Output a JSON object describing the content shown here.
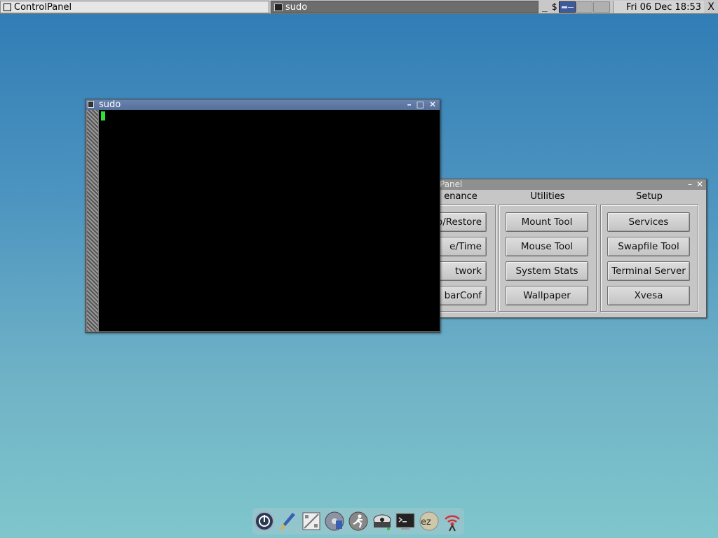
{
  "taskbar": {
    "tasks": [
      {
        "label": "ControlPanel",
        "active": false
      },
      {
        "label": "sudo",
        "active": true
      }
    ],
    "tray_minimize": "_",
    "tray_shell": "$",
    "clock": "Fri 06 Dec 18:53",
    "close_glyph": "X"
  },
  "terminal": {
    "title": "sudo",
    "minimize_glyph": "–",
    "maximize_glyph": "□",
    "close_glyph": "✕",
    "cursor_color": "#2fe03a"
  },
  "control_panel": {
    "title_visible": "Panel",
    "minimize_glyph": "–",
    "close_glyph": "✕",
    "sections": [
      {
        "name": "enance",
        "buttons": [
          "p/Restore",
          "e/Time",
          "twork",
          "barConf"
        ]
      },
      {
        "name": "Utilities",
        "buttons": [
          "Mount Tool",
          "Mouse Tool",
          "System Stats",
          "Wallpaper"
        ]
      },
      {
        "name": "Setup",
        "buttons": [
          "Services",
          "Swapfile Tool",
          "Terminal Server",
          "Xvesa"
        ]
      }
    ]
  },
  "dock": {
    "icons": [
      "power-icon",
      "paintbrush-icon",
      "calculator-icon",
      "disk-icon",
      "runner-icon",
      "drive-icon",
      "terminal-icon",
      "ezoom-icon",
      "wifi-icon"
    ],
    "ezoom_text": "ez"
  },
  "colors": {
    "desktop_top": "#2f7bb4",
    "desktop_bottom": "#7fc6cc",
    "term_titlebar": "#5f79a5",
    "panel_bg": "#c6c6c6"
  }
}
